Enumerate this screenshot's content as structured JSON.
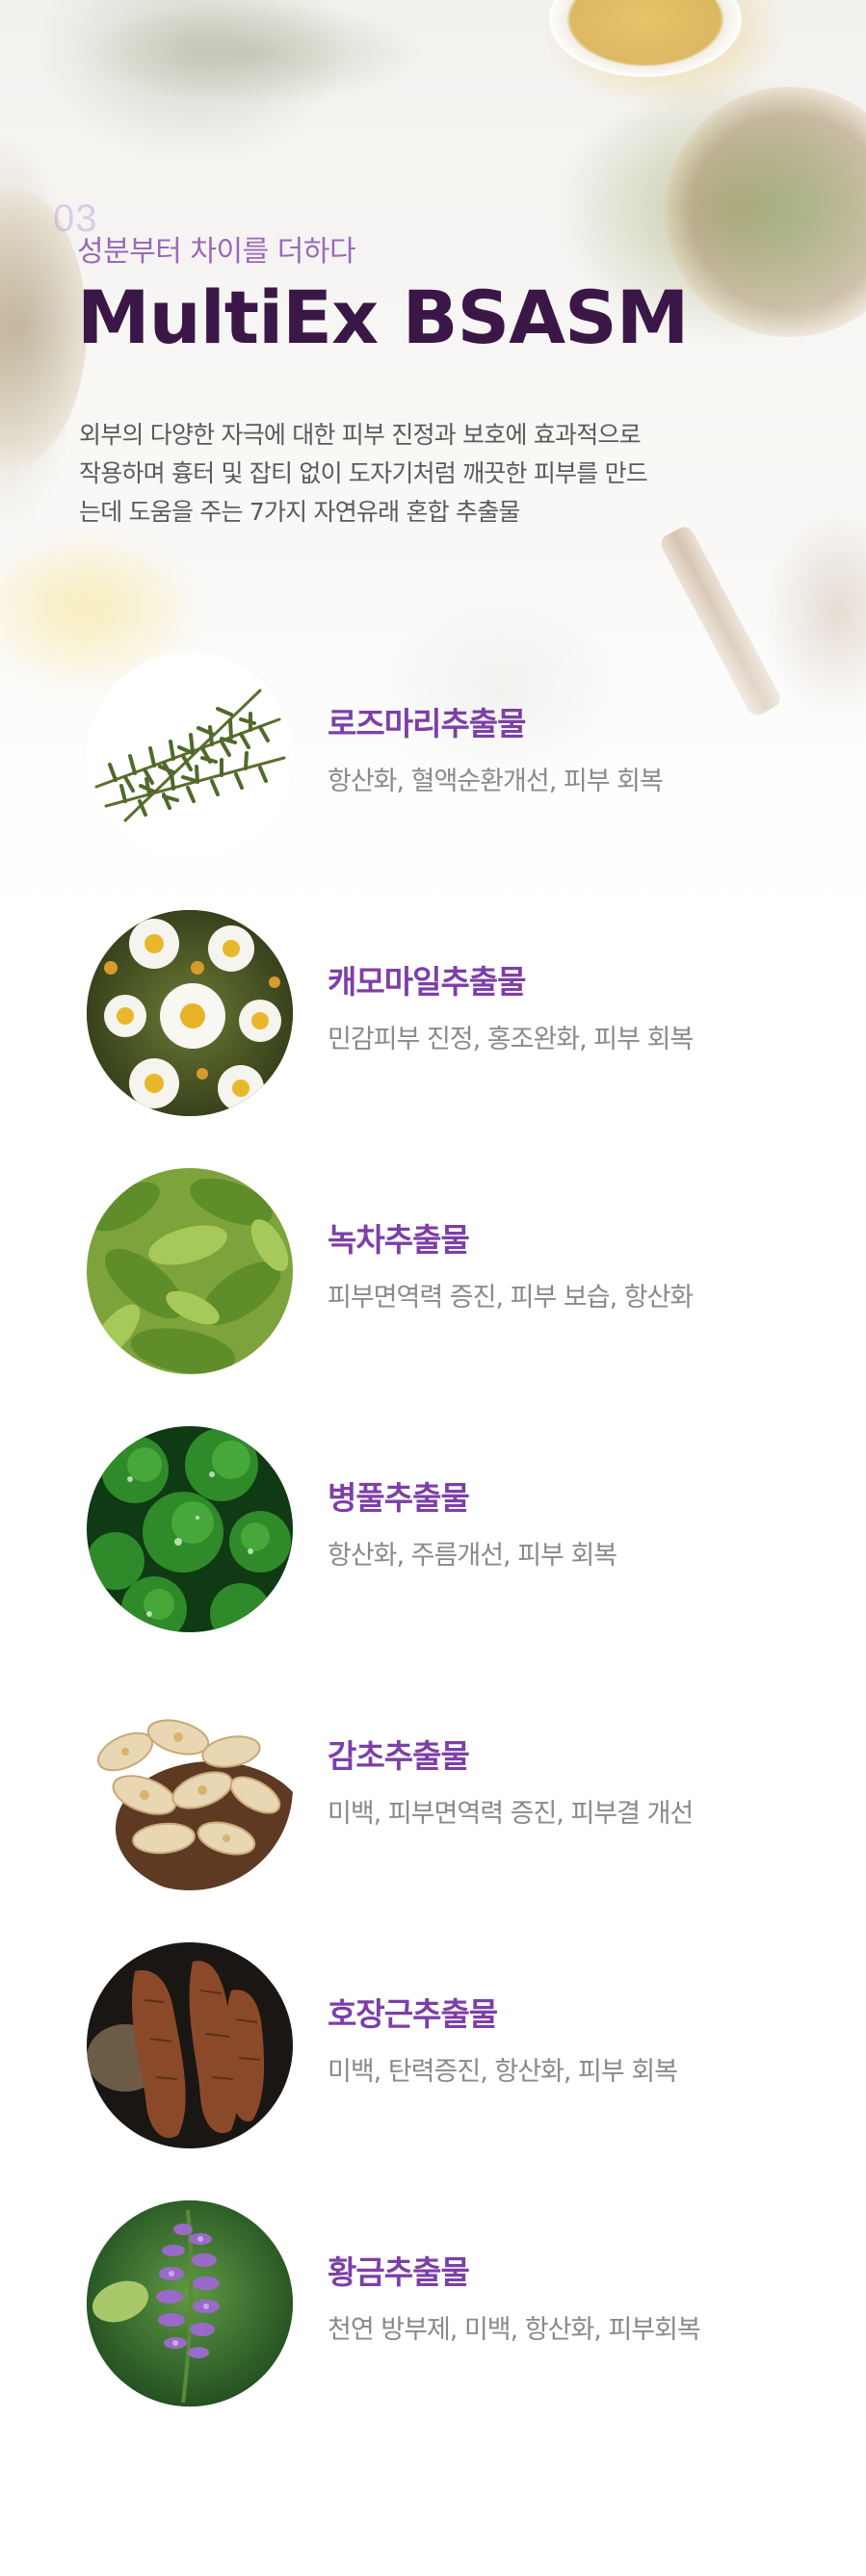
{
  "header": {
    "section_number": "03",
    "eyebrow": "성분부터 차이를 더하다",
    "title": "MultiEx BSASM",
    "description_lines": [
      "외부의 다양한 자극에 대한 피부 진정과 보호에 효과적으로",
      "작용하며 흉터 및 잡티 없이 도자기처럼 깨끗한 피부를 만드",
      "는데 도움을 주는 7가지 자연유래 혼합 추출물"
    ]
  },
  "ingredients": [
    {
      "name": "로즈마리추출물",
      "benefits": "항산화, 혈액순환개선, 피부 회복",
      "icon": "rosemary-icon"
    },
    {
      "name": "캐모마일추출물",
      "benefits": "민감피부 진정, 홍조완화, 피부 회복",
      "icon": "chamomile-icon"
    },
    {
      "name": "녹차추출물",
      "benefits": "피부면역력 증진, 피부 보습, 항산화",
      "icon": "green-tea-icon"
    },
    {
      "name": "병풀추출물",
      "benefits": "항산화, 주름개선, 피부 회복",
      "icon": "centella-icon"
    },
    {
      "name": "감초추출물",
      "benefits": "미백, 피부면역력 증진, 피부결 개선",
      "icon": "licorice-icon"
    },
    {
      "name": "호장근추출물",
      "benefits": "미백, 탄력증진, 항산화, 피부 회복",
      "icon": "knotweed-root-icon"
    },
    {
      "name": "황금추출물",
      "benefits": "천연 방부제, 미백, 항산화, 피부회복",
      "icon": "skullcap-icon"
    }
  ],
  "colors": {
    "title": "#3b1747",
    "eyebrow": "#9a69b9",
    "ingredient_name": "#7d3fa7",
    "body_text": "#5a5a5a",
    "benefit_text": "#8a8a8a"
  }
}
